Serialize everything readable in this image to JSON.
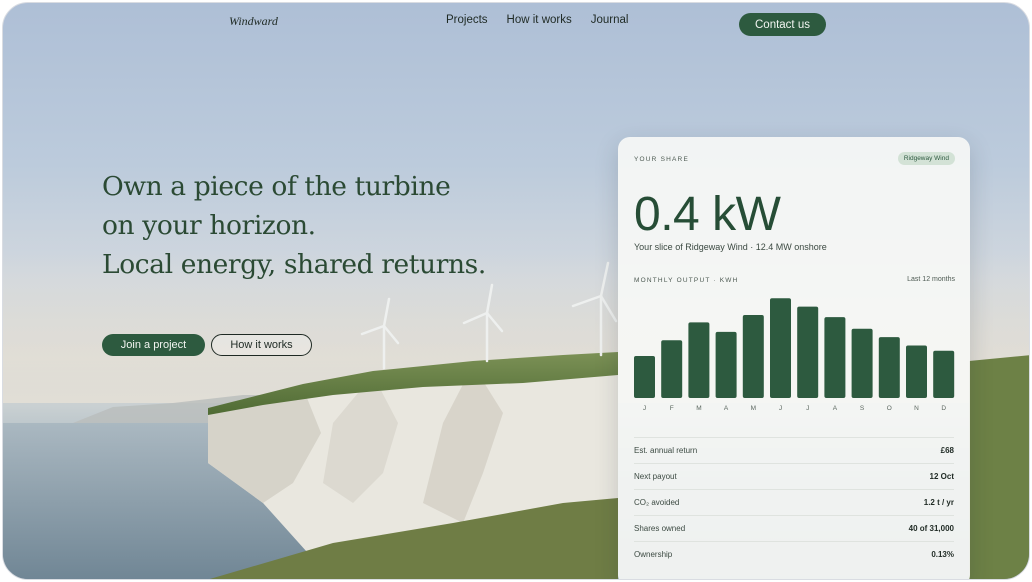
{
  "brand": {
    "logo": "Windward"
  },
  "nav": {
    "items": [
      "Projects",
      "How it works",
      "Journal"
    ],
    "contact": "Contact us"
  },
  "hero": {
    "lines": [
      "Own a piece of the turbine",
      "on your horizon.",
      "Local energy, shared returns."
    ],
    "cta_primary": "Join a project",
    "cta_secondary": "How it works"
  },
  "card": {
    "eyebrow": "YOUR SHARE",
    "badge": "Ridgeway Wind",
    "big_value": "0.4 kW",
    "subtitle": "Your slice of Ridgeway Wind · 12.4 MW onshore",
    "chart_label": "MONTHLY OUTPUT · KWH",
    "chart_range": "Last 12 months",
    "stats": [
      {
        "label": "Est. annual return",
        "value": "£68"
      },
      {
        "label": "Next payout",
        "value": "12 Oct"
      },
      {
        "label": "CO₂ avoided",
        "value": "1.2 t / yr"
      },
      {
        "label": "Shares owned",
        "value": "40 of 31,000"
      },
      {
        "label": "Ownership",
        "value": "0.13%"
      }
    ]
  },
  "colors": {
    "accent": "#2d5a3f",
    "headline": "#2b4a34"
  },
  "chart_data": {
    "type": "bar",
    "categories": [
      "J",
      "F",
      "M",
      "A",
      "M",
      "J",
      "J",
      "A",
      "S",
      "O",
      "N",
      "D"
    ],
    "values": [
      40,
      55,
      72,
      63,
      79,
      95,
      87,
      77,
      66,
      58,
      50,
      45
    ],
    "ylim": [
      0,
      100
    ],
    "grid": false,
    "color": "#2d5a3f"
  }
}
